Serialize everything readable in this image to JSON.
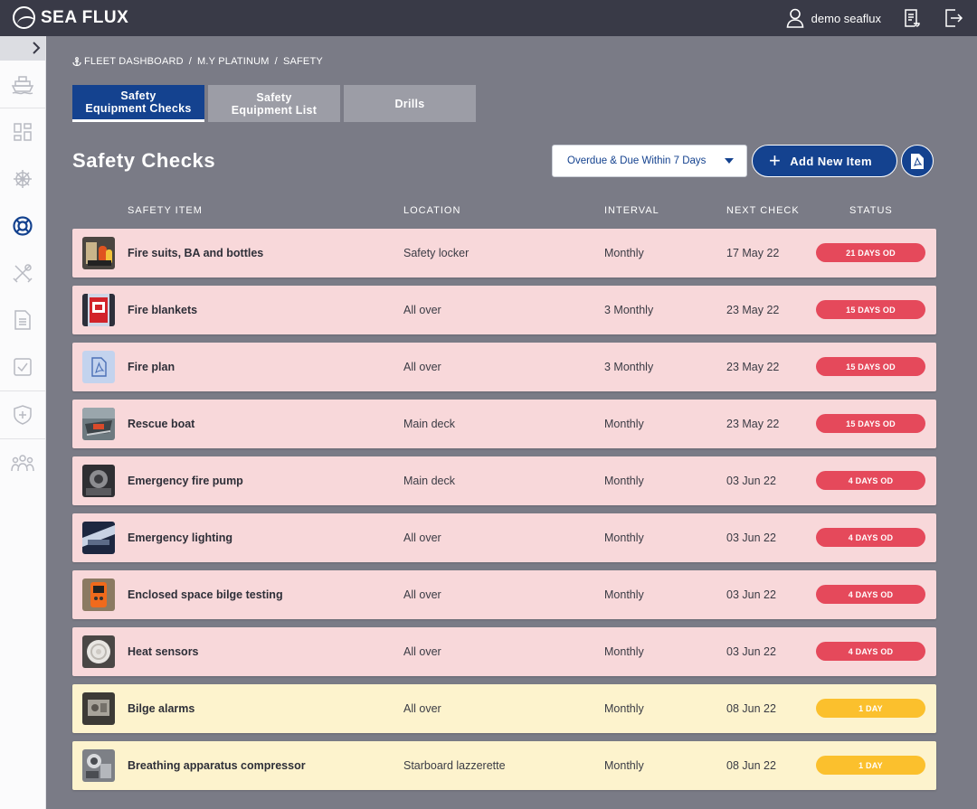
{
  "app": {
    "name": "SEA FLUX"
  },
  "user": {
    "name": "demo seaflux"
  },
  "breadcrumb": [
    "FLEET DASHBOARD",
    "M.Y PLATINUM",
    "SAFETY"
  ],
  "tabs": [
    {
      "label": "Safety\nEquipment Checks",
      "active": true
    },
    {
      "label": "Safety\nEquipment List",
      "active": false
    },
    {
      "label": "Drills",
      "active": false
    }
  ],
  "page": {
    "title": "Safety Checks"
  },
  "filter": {
    "value": "Overdue & Due Within 7 Days"
  },
  "actions": {
    "add_label": "Add New Item"
  },
  "columns": {
    "item": "SAFETY ITEM",
    "location": "LOCATION",
    "interval": "INTERVAL",
    "next": "NEXT CHECK",
    "status": "STATUS"
  },
  "colors": {
    "brand": "#14428f",
    "overdue_row": "#f8d8da",
    "due_row": "#fdf3cd",
    "overdue_badge": "#e5495b",
    "due_badge": "#fbc02d"
  },
  "rows": [
    {
      "name": "Fire suits, BA and bottles",
      "location": "Safety locker",
      "interval": "Monthly",
      "next": "17 May 22",
      "status": "21 DAYS OD",
      "level": "od",
      "thumb": "fire-suits-photo"
    },
    {
      "name": "Fire blankets",
      "location": "All over",
      "interval": "3 Monthly",
      "next": "23 May 22",
      "status": "15 DAYS OD",
      "level": "od",
      "thumb": "fire-blanket-photo"
    },
    {
      "name": "Fire plan",
      "location": "All over",
      "interval": "3 Monthly",
      "next": "23 May 22",
      "status": "15 DAYS OD",
      "level": "od",
      "thumb": "pdf-file-icon"
    },
    {
      "name": "Rescue boat",
      "location": "Main deck",
      "interval": "Monthly",
      "next": "23 May 22",
      "status": "15 DAYS OD",
      "level": "od",
      "thumb": "rescue-boat-photo"
    },
    {
      "name": "Emergency fire pump",
      "location": "Main deck",
      "interval": "Monthly",
      "next": "03 Jun 22",
      "status": "4 DAYS OD",
      "level": "od",
      "thumb": "fire-pump-photo"
    },
    {
      "name": "Emergency lighting",
      "location": "All over",
      "interval": "Monthly",
      "next": "03 Jun 22",
      "status": "4 DAYS OD",
      "level": "od",
      "thumb": "lighting-photo"
    },
    {
      "name": "Enclosed space bilge testing",
      "location": "All over",
      "interval": "Monthly",
      "next": "03 Jun 22",
      "status": "4 DAYS OD",
      "level": "od",
      "thumb": "gas-detector-photo"
    },
    {
      "name": "Heat sensors",
      "location": "All over",
      "interval": "Monthly",
      "next": "03 Jun 22",
      "status": "4 DAYS OD",
      "level": "od",
      "thumb": "heat-sensor-photo"
    },
    {
      "name": "Bilge alarms",
      "location": "All over",
      "interval": "Monthly",
      "next": "08 Jun 22",
      "status": "1 DAY",
      "level": "due",
      "thumb": "bilge-alarm-photo"
    },
    {
      "name": "Breathing apparatus compressor",
      "location": "Starboard lazzerette",
      "interval": "Monthly",
      "next": "08 Jun 22",
      "status": "1 DAY",
      "level": "due",
      "thumb": "compressor-photo"
    }
  ]
}
